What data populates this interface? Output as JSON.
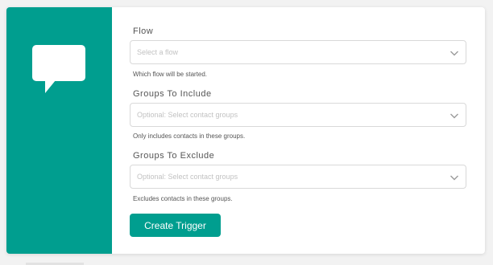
{
  "icon": "chat-bubble-icon",
  "colors": {
    "accent": "#009e8f",
    "background": "#f2f2f2",
    "card": "#ffffff"
  },
  "fields": [
    {
      "label": "Flow",
      "placeholder": "Select a flow",
      "help": "Which flow will be started."
    },
    {
      "label": "Groups To Include",
      "placeholder": "Optional: Select contact groups",
      "help": "Only includes contacts in these groups."
    },
    {
      "label": "Groups To Exclude",
      "placeholder": "Optional: Select contact groups",
      "help": "Excludes contacts in these groups."
    }
  ],
  "submit_label": "Create Trigger"
}
